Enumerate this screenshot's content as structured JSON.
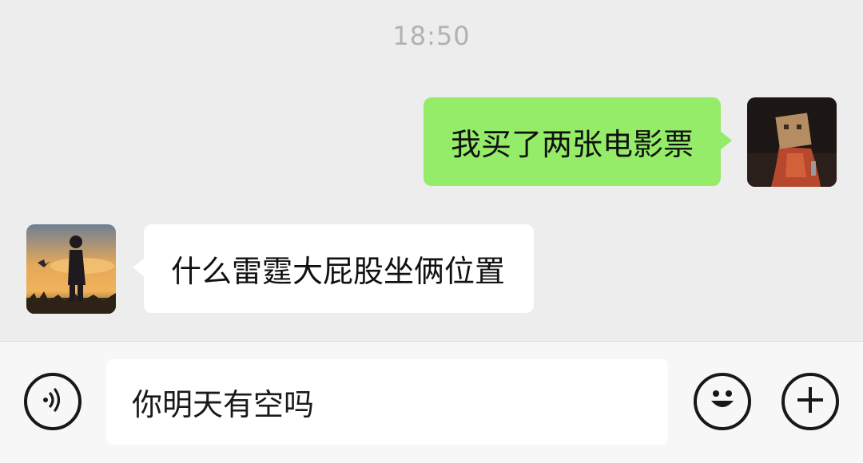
{
  "chat": {
    "timestamp": "18:50",
    "messages": [
      {
        "direction": "sent",
        "text": "我买了两张电影票"
      },
      {
        "direction": "received",
        "text": "什么雷霆大屁股坐俩位置"
      }
    ]
  },
  "input_bar": {
    "text_value": "你明天有空吗",
    "icons": {
      "voice": "voice-icon",
      "emoji": "emoji-icon",
      "plus": "plus-icon"
    }
  },
  "colors": {
    "chat_background": "#ededed",
    "sent_bubble": "#95ec69",
    "received_bubble": "#ffffff",
    "timestamp_text": "#b2b2b2",
    "input_bar_background": "#f7f7f7"
  }
}
